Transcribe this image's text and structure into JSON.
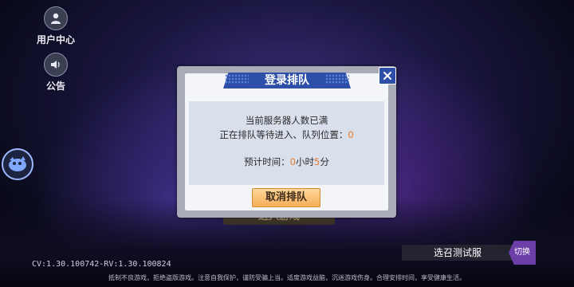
{
  "sidebar": {
    "user_center_label": "用户中心",
    "announcement_label": "公告"
  },
  "background": {
    "enter_game_label": "进入游戏"
  },
  "dialog": {
    "title": "登录排队",
    "line1": "当前服务器人数已满",
    "line2_prefix": "正在排队等待进入、队列位置：",
    "queue_position": "0",
    "line3_prefix": "预计时间：",
    "hours": "0",
    "hours_unit": "小时",
    "minutes": "5",
    "minutes_unit": "分",
    "cancel_label": "取消排队"
  },
  "server": {
    "label": "选召测试服",
    "switch_label": "切换"
  },
  "footer": {
    "version": "CV:1.30.100742-RV:1.30.100824",
    "health_notice": "抵制不良游戏，拒绝盗版游戏。注意自我保护，谨防受骗上当。适度游戏益脑，沉迷游戏伤身。合理安排时间，享受健康生活。"
  },
  "colors": {
    "accent_blue": "#2e4fa8",
    "highlight_orange": "#e8782a",
    "button_orange": "#f6ae5a",
    "switch_purple": "#6c3fa8"
  },
  "icons": {
    "user": "user-icon",
    "announcement": "speaker-icon",
    "mascot": "mascot-icon",
    "close": "close-icon"
  }
}
